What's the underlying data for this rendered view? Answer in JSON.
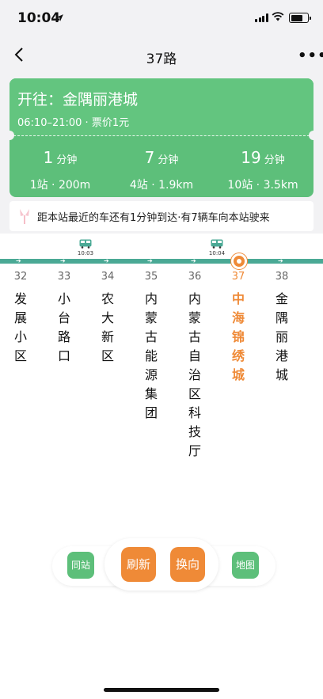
{
  "status_bar": {
    "time": "10:04"
  },
  "nav": {
    "title": "37路",
    "more": "•••"
  },
  "card": {
    "direction": "开往：金隅丽港城",
    "hours_price": "06:10–21:00 · 票价1元",
    "buses": [
      {
        "minutes": "1",
        "unit": "分钟",
        "distance": "1站 · 200m"
      },
      {
        "minutes": "7",
        "unit": "分钟",
        "distance": "4站 · 1.9km"
      },
      {
        "minutes": "19",
        "unit": "分钟",
        "distance": "10站 · 3.5km"
      }
    ]
  },
  "notice": {
    "text": "距本站最近的车还有1分钟到达·有7辆车向本站驶来"
  },
  "route": {
    "bus_times": [
      "10:03",
      "10:04"
    ],
    "stations": [
      {
        "num": "32",
        "name": "发展小区"
      },
      {
        "num": "33",
        "name": "小台路口"
      },
      {
        "num": "34",
        "name": "农大新区"
      },
      {
        "num": "35",
        "name": "内蒙古能源集团"
      },
      {
        "num": "36",
        "name": "内蒙古自治区科技厅"
      },
      {
        "num": "37",
        "name": "中海锦绣城"
      },
      {
        "num": "38",
        "name": "金隅丽港城"
      }
    ],
    "current_index": 5
  },
  "actions": {
    "same_station": "同站",
    "refresh": "刷新",
    "switch": "换向",
    "map": "地图"
  },
  "colors": {
    "green": "#5dbf7a",
    "orange": "#ef8a37",
    "route": "#4aa995"
  }
}
